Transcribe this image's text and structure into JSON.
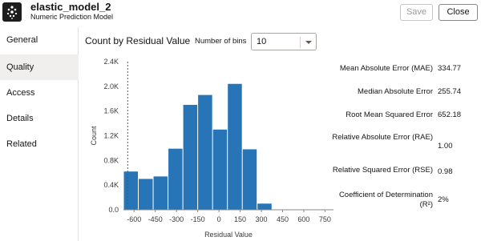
{
  "header": {
    "title": "elastic_model_2",
    "subtitle": "Numeric Prediction Model",
    "save_label": "Save",
    "close_label": "Close"
  },
  "sidebar": {
    "items": [
      {
        "label": "General",
        "active": false
      },
      {
        "label": "Quality",
        "active": true
      },
      {
        "label": "Access",
        "active": false
      },
      {
        "label": "Details",
        "active": false
      },
      {
        "label": "Related",
        "active": false
      }
    ]
  },
  "chart_header": {
    "title": "Count by Residual Value",
    "bins_label": "Number of bins",
    "bins_value": "10"
  },
  "metrics": [
    {
      "name": "Mean Absolute Error (MAE)",
      "value": "334.77"
    },
    {
      "name": "Median Absolute Error",
      "value": "255.74"
    },
    {
      "name": "Root Mean Squared Error",
      "value": "652.18"
    },
    {
      "name": "Relative Absolute Error (RAE)",
      "value": "1.00"
    },
    {
      "name": "Relative Squared Error (RSE)",
      "value": "0.98"
    },
    {
      "name": "Coefficient of Determination (R²)",
      "value": "2%"
    }
  ],
  "colors": {
    "bar": "#2775b6",
    "axis": "#8a8784",
    "grid": "#eeeeee"
  },
  "chart_data": {
    "type": "bar",
    "title": "Count by Residual Value",
    "xlabel": "Residual Value",
    "ylabel": "Count",
    "bins": [
      {
        "start": -675,
        "end": -570,
        "value": 620
      },
      {
        "start": -570,
        "end": -465,
        "value": 500
      },
      {
        "start": -465,
        "end": -360,
        "value": 540
      },
      {
        "start": -360,
        "end": -255,
        "value": 990
      },
      {
        "start": -255,
        "end": -150,
        "value": 1700
      },
      {
        "start": -150,
        "end": -45,
        "value": 1860
      },
      {
        "start": -45,
        "end": 60,
        "value": 1300
      },
      {
        "start": 60,
        "end": 165,
        "value": 2040
      },
      {
        "start": 165,
        "end": 270,
        "value": 980
      },
      {
        "start": 270,
        "end": 375,
        "value": 100
      }
    ],
    "y_ticks": [
      0,
      400,
      800,
      1200,
      1600,
      2000,
      2400
    ],
    "y_tick_labels": [
      "0.0",
      "0.4K",
      "0.8K",
      "1.2K",
      "1.6K",
      "2.0K",
      "2.4K"
    ],
    "x_ticks": [
      -600,
      -450,
      -300,
      -150,
      0,
      150,
      300,
      450,
      600,
      750
    ],
    "x_tick_labels": [
      "-600",
      "-450",
      "-300",
      "-150",
      "0",
      "150",
      "300",
      "450",
      "600",
      "750"
    ],
    "ylim": [
      0,
      2400
    ],
    "reference_line_x": -645,
    "grid": false
  }
}
